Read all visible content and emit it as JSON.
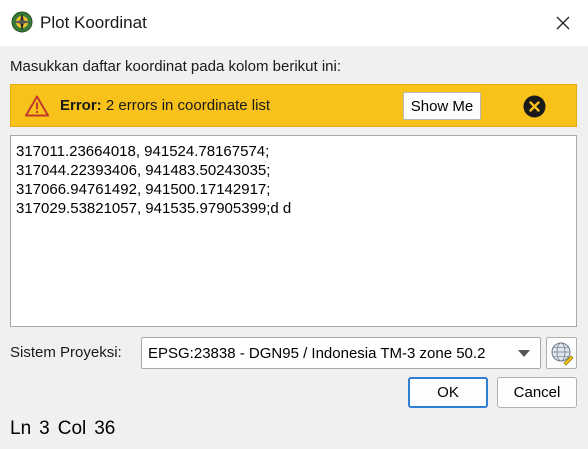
{
  "window": {
    "title": "Plot Koordinat",
    "icon": "globe-compass-icon"
  },
  "prompt": "Masukkan daftar koordinat pada kolom berikut ini:",
  "error_banner": {
    "label": "Error:",
    "message": " 2 errors in coordinate list",
    "show_me": "Show Me",
    "color": "#f8c21b"
  },
  "coordinates": {
    "lines": [
      "317011.23664018, 941524.78167574;",
      "317044.22393406, 941483.50243035;",
      "317066.94761492, 941500.17142917;",
      "317029.53821057, 941535.97905399;d d"
    ]
  },
  "projection": {
    "label": "Sistem Proyeksi:",
    "selected": "EPSG:23838 - DGN95 / Indonesia TM-3 zone 50.2"
  },
  "buttons": {
    "ok": "OK",
    "cancel": "Cancel"
  },
  "status": {
    "ln_label": "Ln",
    "ln": "3",
    "col_label": "Col",
    "col": "36"
  }
}
